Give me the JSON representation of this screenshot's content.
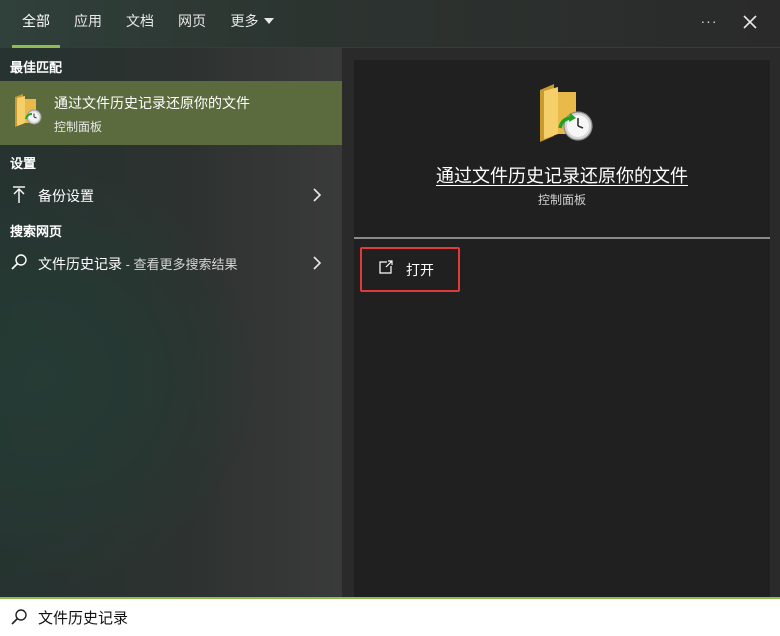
{
  "tabs": [
    {
      "label": "全部",
      "active": true
    },
    {
      "label": "应用"
    },
    {
      "label": "文档"
    },
    {
      "label": "网页"
    },
    {
      "label": "更多"
    }
  ],
  "window_controls": {
    "more_label": "···",
    "close_icon": "close-icon"
  },
  "sections": {
    "best_match": "最佳匹配",
    "settings": "设置",
    "web": "搜索网页"
  },
  "best_match_item": {
    "title": "通过文件历史记录还原你的文件",
    "subtitle": "控制面板",
    "icon": "folder-clock-icon"
  },
  "settings_items": [
    {
      "label": "备份设置",
      "icon": "upload-arrow-icon"
    }
  ],
  "web_items": [
    {
      "label": "文件历史记录",
      "suffix": " - 查看更多搜索结果",
      "icon": "search-icon"
    }
  ],
  "detail": {
    "title": "通过文件历史记录还原你的文件",
    "subtitle": "控制面板",
    "actions": [
      {
        "label": "打开",
        "icon": "open-external-icon"
      }
    ]
  },
  "search": {
    "value": "文件历史记录",
    "placeholder": ""
  },
  "colors": {
    "accent": "#8fbc4f",
    "best_match_bg": "#5b6b3d",
    "highlight_box": "#e23a3a"
  }
}
